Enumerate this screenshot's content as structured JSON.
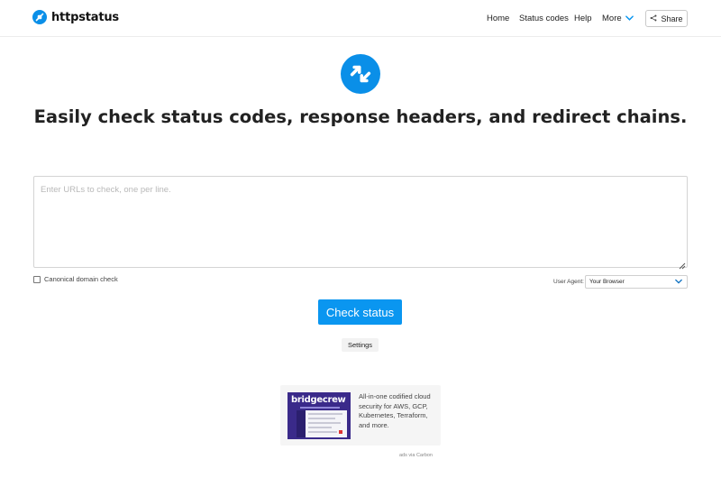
{
  "header": {
    "logo_text": "httpstatus",
    "nav": {
      "home": "Home",
      "status_codes": "Status codes",
      "help": "Help",
      "more": "More"
    },
    "share_label": "Share"
  },
  "hero": {
    "headline_parts": [
      "Easily check ",
      "status codes",
      ", ",
      "response headers",
      ", and ",
      "redirect chains",
      "."
    ]
  },
  "form": {
    "urls_placeholder": "Enter URLs to check, one per line.",
    "urls_value": "",
    "canonical_label": "Canonical domain check",
    "canonical_checked": false,
    "user_agent_label": "User Agent:",
    "user_agent_selected": "Your Browser",
    "check_button": "Check status",
    "settings_button": "Settings"
  },
  "ad": {
    "brand": "bridgecrew",
    "text": "All-in-one codified cloud security for AWS, GCP, Kubernetes, Terraform, and more.",
    "via": "ads via Carbon"
  },
  "colors": {
    "accent": "#0a96f0",
    "logo": "#0a8fe8"
  },
  "icons": {
    "logo": "arrows-redirect-icon",
    "share": "share-icon",
    "more": "chevron-down-icon",
    "select": "chevron-down-icon"
  }
}
